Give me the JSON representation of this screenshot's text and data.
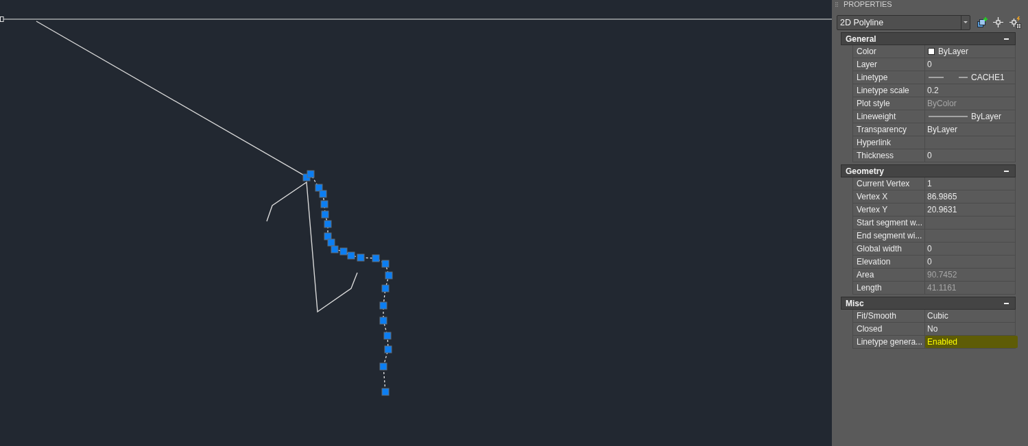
{
  "panel": {
    "title": "PROPERTIES",
    "object_type": "2D Polyline",
    "sections": [
      {
        "title": "General",
        "expanded": true,
        "rows": [
          {
            "label": "Color",
            "value": "ByLayer",
            "kind": "color",
            "disabled": false,
            "highlighted": false
          },
          {
            "label": "Layer",
            "value": "0",
            "kind": "text",
            "disabled": false,
            "highlighted": false
          },
          {
            "label": "Linetype",
            "value": "CACHE1",
            "kind": "linetype",
            "disabled": false,
            "highlighted": false
          },
          {
            "label": "Linetype scale",
            "value": "0.2",
            "kind": "text",
            "disabled": false,
            "highlighted": false
          },
          {
            "label": "Plot style",
            "value": "ByColor",
            "kind": "text",
            "disabled": true,
            "highlighted": false
          },
          {
            "label": "Lineweight",
            "value": "ByLayer",
            "kind": "lineweight",
            "disabled": false,
            "highlighted": false
          },
          {
            "label": "Transparency",
            "value": "ByLayer",
            "kind": "text",
            "disabled": false,
            "highlighted": false
          },
          {
            "label": "Hyperlink",
            "kind": "text",
            "disabled": false,
            "highlighted": false
          },
          {
            "label": "Thickness",
            "value": "0",
            "kind": "text",
            "disabled": false,
            "highlighted": false
          }
        ]
      },
      {
        "title": "Geometry",
        "expanded": true,
        "rows": [
          {
            "label": "Current Vertex",
            "value": "1",
            "kind": "text",
            "disabled": false,
            "highlighted": false
          },
          {
            "label": "Vertex X",
            "value": "86.9865",
            "kind": "text",
            "disabled": false,
            "highlighted": false
          },
          {
            "label": "Vertex Y",
            "value": "20.9631",
            "kind": "text",
            "disabled": false,
            "highlighted": false
          },
          {
            "label": "Start segment w...",
            "kind": "text",
            "disabled": false,
            "highlighted": false
          },
          {
            "label": "End segment wi...",
            "kind": "text",
            "disabled": false,
            "highlighted": false
          },
          {
            "label": "Global width",
            "value": "0",
            "kind": "text",
            "disabled": false,
            "highlighted": false
          },
          {
            "label": "Elevation",
            "value": "0",
            "kind": "text",
            "disabled": false,
            "highlighted": false
          },
          {
            "label": "Area",
            "value": "90.7452",
            "kind": "text",
            "disabled": true,
            "highlighted": false
          },
          {
            "label": "Length",
            "value": "41.1161",
            "kind": "text",
            "disabled": true,
            "highlighted": false
          }
        ]
      },
      {
        "title": "Misc",
        "expanded": true,
        "rows": [
          {
            "label": "Fit/Smooth",
            "value": "Cubic",
            "kind": "text",
            "disabled": false,
            "highlighted": false
          },
          {
            "label": "Closed",
            "value": "No",
            "kind": "text",
            "disabled": false,
            "highlighted": false
          },
          {
            "label": "Linetype genera...",
            "value": "Enabled",
            "kind": "text",
            "disabled": false,
            "highlighted": true
          }
        ]
      }
    ]
  }
}
